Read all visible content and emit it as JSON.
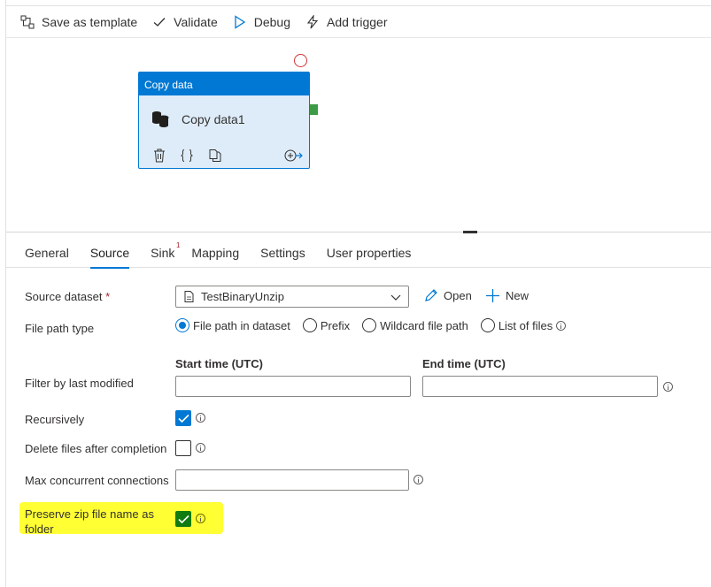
{
  "toolbar": {
    "save_template": "Save as template",
    "validate": "Validate",
    "debug": "Debug",
    "add_trigger": "Add trigger"
  },
  "activity": {
    "header": "Copy data",
    "name": "Copy data1"
  },
  "tabs": [
    {
      "label": "General"
    },
    {
      "label": "Source"
    },
    {
      "label": "Sink",
      "badge": "1"
    },
    {
      "label": "Mapping"
    },
    {
      "label": "Settings"
    },
    {
      "label": "User properties"
    }
  ],
  "active_tab": "Source",
  "source": {
    "dataset_label": "Source dataset",
    "required_mark": "*",
    "dataset_value": "TestBinaryUnzip",
    "open_label": "Open",
    "new_label": "New",
    "file_path_type_label": "File path type",
    "file_path_options": [
      "File path in dataset",
      "Prefix",
      "Wildcard file path",
      "List of files"
    ],
    "file_path_selected": "File path in dataset",
    "filter_label": "Filter by last modified",
    "start_time_label": "Start time (UTC)",
    "end_time_label": "End time (UTC)",
    "start_time_value": "",
    "end_time_value": "",
    "recursively_label": "Recursively",
    "recursively_checked": true,
    "delete_files_label": "Delete files after completion",
    "delete_files_checked": false,
    "max_conn_label": "Max concurrent connections",
    "max_conn_value": "",
    "preserve_zip_label_line1": "Preserve zip file name as",
    "preserve_zip_label_line2": "folder",
    "preserve_zip_checked": true
  },
  "colors": {
    "accent": "#0078d4",
    "success": "#3b9b47",
    "error": "#d13438",
    "highlight": "#ffff33",
    "checked_dark": "#107c10"
  }
}
